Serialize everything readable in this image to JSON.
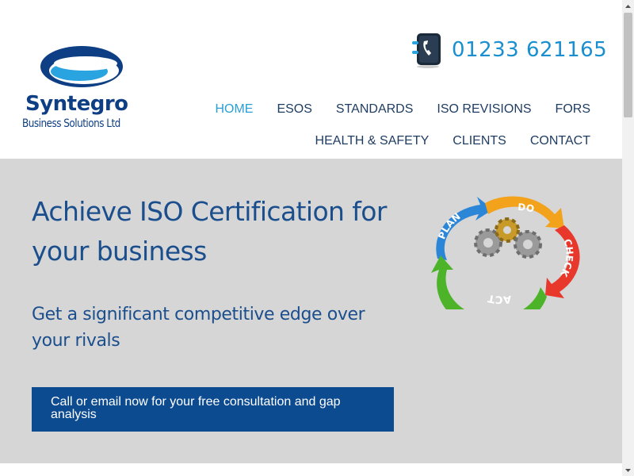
{
  "brand": {
    "name": "Syntegro",
    "tagline": "Business Solutions Ltd"
  },
  "header": {
    "phone": "01233 621165"
  },
  "nav": {
    "row1": [
      {
        "label": "HOME",
        "active": true
      },
      {
        "label": "ESOS",
        "active": false
      },
      {
        "label": "STANDARDS",
        "active": false
      },
      {
        "label": "ISO REVISIONS",
        "active": false
      },
      {
        "label": "FORS",
        "active": false
      }
    ],
    "row2": [
      {
        "label": "HEALTH & SAFETY",
        "active": false
      },
      {
        "label": "CLIENTS",
        "active": false
      },
      {
        "label": "CONTACT",
        "active": false
      }
    ]
  },
  "hero": {
    "title": "Achieve ISO Certification for your business",
    "subtitle": "Get a significant competitive edge over your rivals",
    "cta_label": "Call or email now for your free consultation and gap analysis"
  },
  "pdca": {
    "plan": "PLAN",
    "do": "DO",
    "check": "CHECK",
    "act": "ACT"
  },
  "colors": {
    "brand_navy": "#0e3f84",
    "accent_blue": "#2a9fd6",
    "hero_bg": "#d6d6d6",
    "cta_bg": "#0d4b91"
  }
}
